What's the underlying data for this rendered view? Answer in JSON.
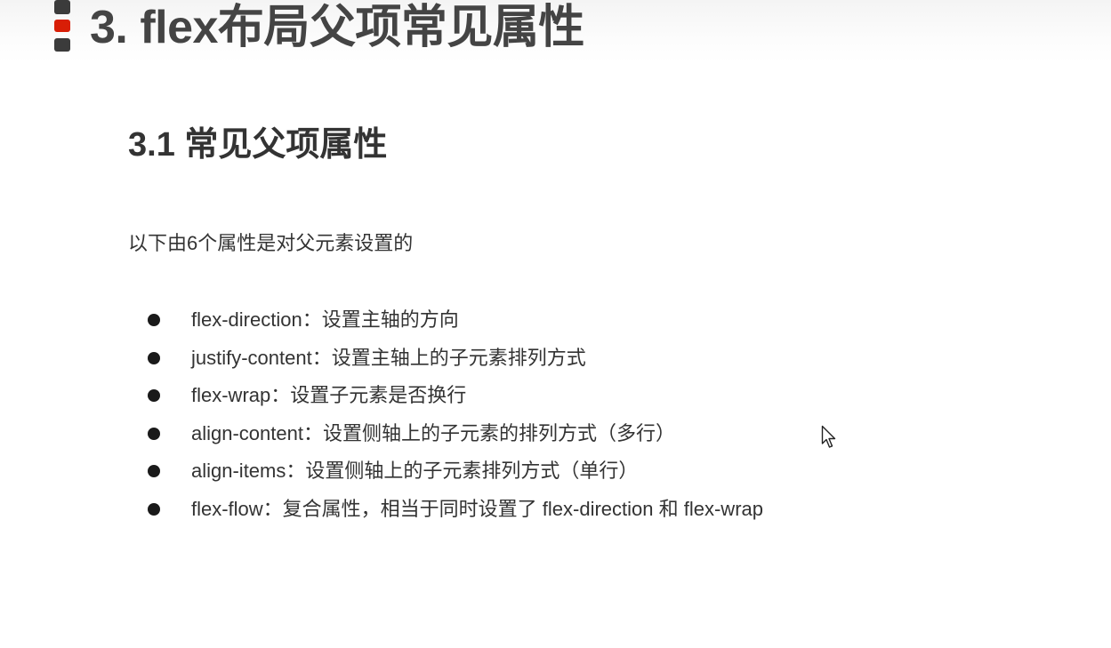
{
  "title": "3. flex布局父项常见属性",
  "section_title": "3.1 常见父项属性",
  "intro": "以下由6个属性是对父元素设置的",
  "properties": [
    "flex-direction：设置主轴的方向",
    "justify-content：设置主轴上的子元素排列方式",
    "flex-wrap：设置子元素是否换行",
    "align-content：设置侧轴上的子元素的排列方式（多行）",
    "align-items：设置侧轴上的子元素排列方式（单行）",
    "flex-flow：复合属性，相当于同时设置了 flex-direction 和 flex-wrap"
  ],
  "icons": {
    "title_marker": "title-marker-icon",
    "bullet": "bullet-icon",
    "cursor": "mouse-cursor-icon"
  },
  "colors": {
    "accent_red": "#d81e06",
    "marker_dark": "#3b3b3b",
    "title_text": "#444444",
    "body_text": "#333333"
  }
}
